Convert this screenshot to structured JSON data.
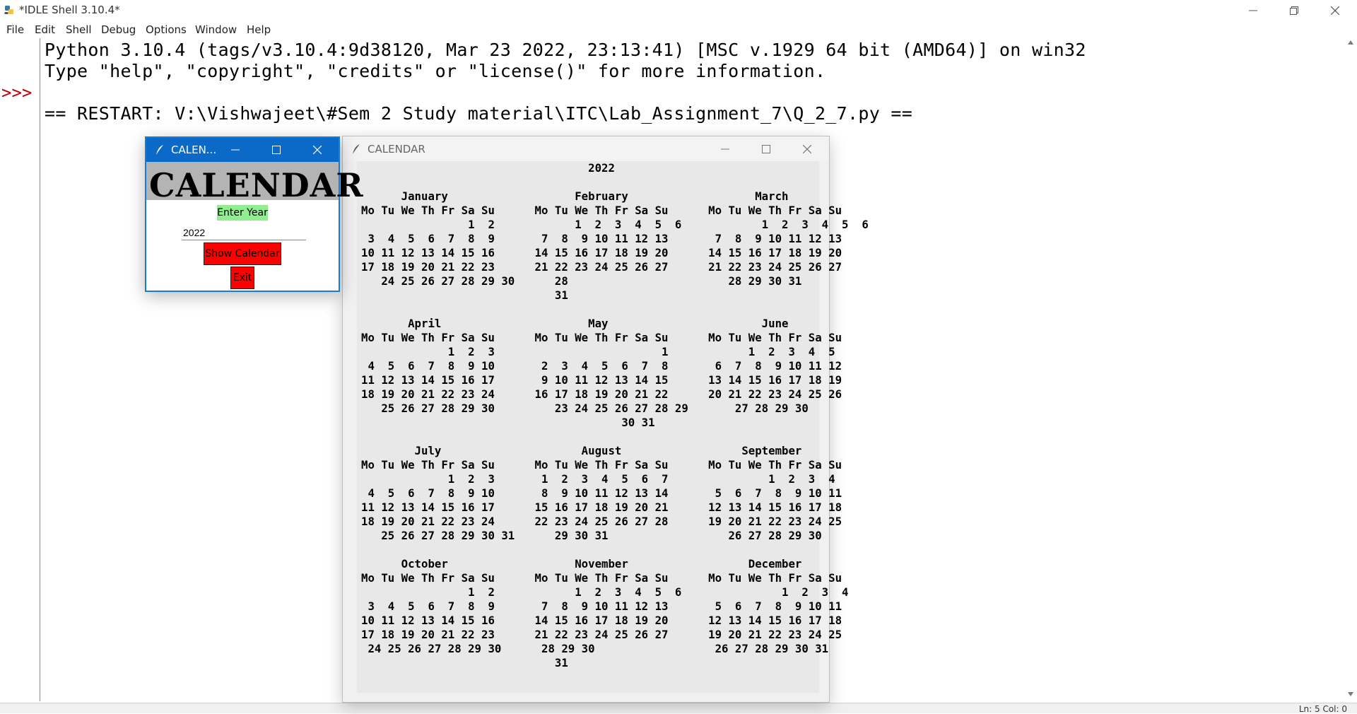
{
  "window": {
    "title": "*IDLE Shell 3.10.4*"
  },
  "menu": [
    "File",
    "Edit",
    "Shell",
    "Debug",
    "Options",
    "Window",
    "Help"
  ],
  "shell": {
    "prompt": ">>>",
    "lines": [
      "Python 3.10.4 (tags/v3.10.4:9d38120, Mar 23 2022, 23:13:41) [MSC v.1929 64 bit (AMD64)] on win32",
      "Type \"help\", \"copyright\", \"credits\" or \"license()\" for more information.",
      "== RESTART: V:\\Vishwajeet\\#Sem 2 Study material\\ITC\\Lab_Assignment_7\\Q_2_7.py =="
    ]
  },
  "status": {
    "position": "Ln: 5   Col: 0"
  },
  "small_window": {
    "title": "CALEN...",
    "heading": "CALENDAR",
    "enter_year_label": "Enter Year",
    "year_value": "2022",
    "show_button": "Show Calendar",
    "exit_button": "Exit"
  },
  "calendar_window": {
    "title": "CALENDAR",
    "text": "                                  2022\n\n      January                   February                   March\nMo Tu We Th Fr Sa Su      Mo Tu We Th Fr Sa Su      Mo Tu We Th Fr Sa Su\n                1  2            1  2  3  4  5  6            1  2  3  4  5  6\n 3  4  5  6  7  8  9       7  8  9 10 11 12 13       7  8  9 10 11 12 13\n10 11 12 13 14 15 16      14 15 16 17 18 19 20      14 15 16 17 18 19 20\n17 18 19 20 21 22 23      21 22 23 24 25 26 27      21 22 23 24 25 26 27\n   24 25 26 27 28 29 30      28                        28 29 30 31\n                             31\n\n       April                      May                       June\nMo Tu We Th Fr Sa Su      Mo Tu We Th Fr Sa Su      Mo Tu We Th Fr Sa Su\n             1  2  3                         1            1  2  3  4  5\n 4  5  6  7  8  9 10       2  3  4  5  6  7  8       6  7  8  9 10 11 12\n11 12 13 14 15 16 17       9 10 11 12 13 14 15      13 14 15 16 17 18 19\n18 19 20 21 22 23 24      16 17 18 19 20 21 22      20 21 22 23 24 25 26\n   25 26 27 28 29 30         23 24 25 26 27 28 29       27 28 29 30\n                                       30 31\n\n        July                     August                  September\nMo Tu We Th Fr Sa Su      Mo Tu We Th Fr Sa Su      Mo Tu We Th Fr Sa Su\n             1  2  3       1  2  3  4  5  6  7               1  2  3  4\n 4  5  6  7  8  9 10       8  9 10 11 12 13 14       5  6  7  8  9 10 11\n11 12 13 14 15 16 17      15 16 17 18 19 20 21      12 13 14 15 16 17 18\n18 19 20 21 22 23 24      22 23 24 25 26 27 28      19 20 21 22 23 24 25\n   25 26 27 28 29 30 31      29 30 31                  26 27 28 29 30\n\n      October                   November                  December\nMo Tu We Th Fr Sa Su      Mo Tu We Th Fr Sa Su      Mo Tu We Th Fr Sa Su\n                1  2            1  2  3  4  5  6               1  2  3  4\n 3  4  5  6  7  8  9       7  8  9 10 11 12 13       5  6  7  8  9 10 11\n10 11 12 13 14 15 16      14 15 16 17 18 19 20      12 13 14 15 16 17 18\n17 18 19 20 21 22 23      21 22 23 24 25 26 27      19 20 21 22 23 24 25\n 24 25 26 27 28 29 30      28 29 30                  26 27 28 29 30 31\n                             31"
  },
  "colors": {
    "prompt": "#c00000",
    "small_titlebar": "#0b69c7",
    "banner": "#b4b4b4",
    "label_bg": "#90ee90",
    "button_bg": "#ff0000"
  },
  "icons": [
    "python-app-icon",
    "minimize-icon",
    "maximize-icon",
    "restore-icon",
    "close-icon",
    "tk-feather-icon",
    "scroll-up-icon",
    "scroll-down-icon"
  ]
}
